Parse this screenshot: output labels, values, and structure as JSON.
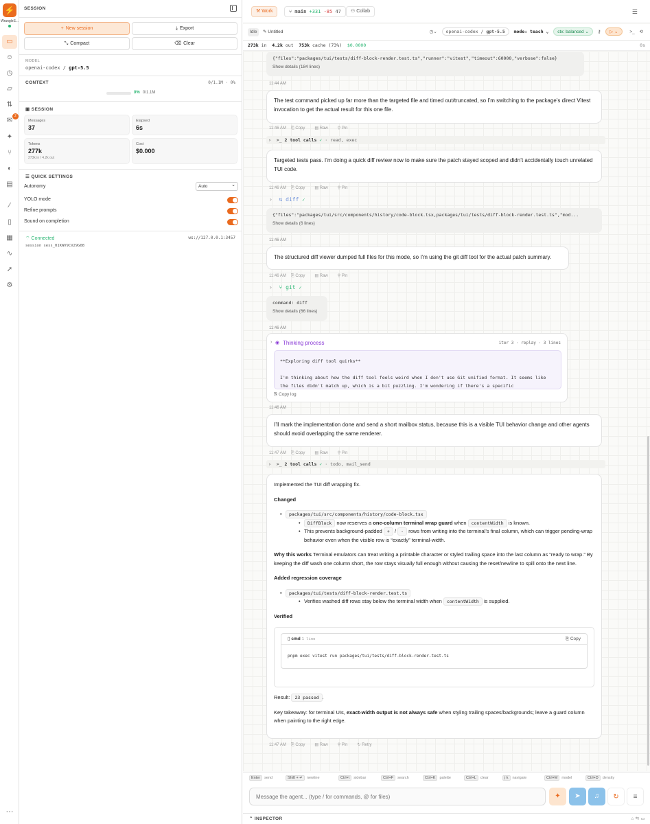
{
  "rail": {
    "brand": "WrangleS...",
    "badge": "2",
    "icons": [
      "chat-icon",
      "robot-icon",
      "history-icon",
      "folder-icon",
      "branches-icon",
      "mail-icon",
      "sparkles-icon",
      "git-icon",
      "palette-icon",
      "archive-icon",
      "wand-icon",
      "document-icon",
      "table-icon",
      "activity-icon",
      "rocket-icon",
      "settings-icon"
    ],
    "more": "···"
  },
  "sidebar": {
    "title": "SESSION",
    "buttons": {
      "new_session": "New session",
      "export": "Export",
      "compact": "Compact",
      "clear": "Clear"
    },
    "model": {
      "label": "MODEL",
      "provider": "openai-codex",
      "sep": "/",
      "name": "gpt-5.5"
    },
    "context": {
      "label": "CONTEXT",
      "right": "0/1.1M · 0%",
      "percent": "0%",
      "capacity": "0/1.1M",
      "fill": 0
    },
    "session": {
      "label": "SESSION",
      "stats": [
        {
          "key": "Messages",
          "value": "37",
          "sub": ""
        },
        {
          "key": "Elapsed",
          "value": "6s",
          "sub": ""
        },
        {
          "key": "Tokens",
          "value": "277k",
          "sub": "273k in / 4.2k out"
        },
        {
          "key": "Cost",
          "value": "$0.000",
          "sub": ""
        }
      ]
    },
    "quick_settings": {
      "label": "QUICK SETTINGS",
      "autonomy_label": "Autonomy",
      "autonomy_value": "Auto",
      "yolo": "YOLO mode",
      "refine": "Refine prompts",
      "sound": "Sound on completion"
    },
    "connection": {
      "status": "Connected",
      "url": "ws://127.0.0.1:3457",
      "session_id": "session sess_01KWV9CV29G08"
    }
  },
  "topbar": {
    "work": "Work",
    "branch": "main",
    "additions": "+331",
    "deletions": "-85",
    "files": "47",
    "collab": "Collab"
  },
  "session_bar": {
    "status": "Idle",
    "title": "Untitled",
    "provider": "openai-codex",
    "model": "gpt-5.5",
    "mode": "mode: teach",
    "ctx": "ctx: balanced"
  },
  "usage": {
    "in": "273k",
    "in_label": "in",
    "out": "4.2k",
    "out_label": "out",
    "cache": "753k",
    "cache_label": "cache (73%)",
    "cost": "$0.0000",
    "right": "0s"
  },
  "chat": {
    "tool_args_1": "{\"files\":\"packages/tui/tests/diff-block-render.test.ts\",\"runner\":\"vitest\",\"timeout\":60000,\"verbose\":false}",
    "show_details_1": "Show details (184 lines)",
    "time_1": "11:44 AM",
    "msg_1": "The test command picked up far more than the targeted file and timed out/truncated, so I’m switching to the package’s direct Vitest invocation to get the actual result for this one file.",
    "time_2": "11:46 AM",
    "tool_calls_1": "2 tool calls",
    "tool_calls_1_detail": "· read, exec",
    "msg_2": "Targeted tests pass. I’m doing a quick diff review now to make sure the patch stayed scoped and didn’t accidentally touch unrelated TUI code.",
    "time_3": "11:46 AM",
    "diff_tool": "diff",
    "tool_args_2": "{\"files\":\"packages/tui/src/components/history/code-block.tsx,packages/tui/tests/diff-block-render.test.ts\",\"mod...",
    "show_details_2": "Show details (6 lines)",
    "time_4": "11:46 AM",
    "msg_3": "The structured diff viewer dumped full files for this mode, so I’m using the git diff tool for the actual patch summary.",
    "time_5": "11:46 AM",
    "git_tool": "git",
    "tool_args_3": "command: diff",
    "show_details_3": "Show details (66 lines)",
    "time_6": "11:46 AM",
    "thinking_title": "Thinking process",
    "thinking_meta": "iter 3 · replay · 3 lines",
    "thinking_line_1": "**Exploring diff tool quirks**",
    "thinking_line_2": "I'm thinking about how the diff tool feels weird when I don't use Git unified format. It seems like the files didn't match up, which is a bit puzzling. I'm wondering if there's a specific",
    "copy_log": "Copy log",
    "time_7": "11:46 AM",
    "msg_4": "I’ll mark the implementation done and send a short mailbox status, because this is a visible TUI behavior change and other agents should avoid overlapping the same renderer.",
    "time_8": "11:47 AM",
    "tool_calls_2": "2 tool calls",
    "tool_calls_2_detail": "· todo, mail_send",
    "time_9": "11:47 AM",
    "actions": {
      "copy": "Copy",
      "raw": "Raw",
      "pin": "Pin",
      "retry": "Retry"
    }
  },
  "final": {
    "intro": "Implemented the TUI diff wrapping fix.",
    "changed_h": "Changed",
    "file_1": "packages/tui/src/components/history/code-block.tsx",
    "b1_code": "DiffBlock",
    "b1_a": "now reserves a",
    "b1_bold": "one-column terminal wrap guard",
    "b1_b": "when",
    "b1_code2": "contentWidth",
    "b1_c": "is known.",
    "b2_a": "This prevents background-padded",
    "b2_plus": "+",
    "b2_slash": "/",
    "b2_minus": "-",
    "b2_b": "rows from writing into the terminal’s final column, which can trigger pending-wrap behavior even when the visible row is “exactly” terminal-width.",
    "why_bold": "Why this works",
    "why_text": "Terminal emulators can treat writing a printable character or styled trailing space into the last column as “ready to wrap.” By keeping the diff wash one column short, the row stays visually full enough without causing the reset/newline to spill onto the next line.",
    "added_h": "Added regression coverage",
    "file_2": "packages/tui/tests/diff-block-render.test.ts",
    "c1_a": "Verifies washed diff rows stay below the terminal width when",
    "c1_code": "contentWidth",
    "c1_b": "is supplied.",
    "verified_h": "Verified",
    "cmd_label": "cmd",
    "cmd_lines": "1 line",
    "cmd_copy": "Copy",
    "cmd": "pnpm exec vitest run packages/tui/tests/diff-block-render.test.ts",
    "result_label": "Result:",
    "result_code": "23 passed",
    "result_end": ".",
    "key_a": "Key takeaway: for terminal UIs,",
    "key_bold": "exact-width output is not always safe",
    "key_b": "when styling trailing spaces/backgrounds; leave a guard column when painting to the right edge."
  },
  "hints": [
    {
      "key": "Enter",
      "label": "send"
    },
    {
      "key": "Shift + ↵",
      "label": "newline"
    },
    {
      "key": "Ctrl+\\",
      "label": "sidebar"
    },
    {
      "key": "Ctrl+F",
      "label": "search"
    },
    {
      "key": "Ctrl+K",
      "label": "palette"
    },
    {
      "key": "Ctrl+L",
      "label": "clear"
    },
    {
      "key": "j k",
      "label": "navigate"
    },
    {
      "key": "Ctrl+M",
      "label": "model"
    },
    {
      "key": "Ctrl+D",
      "label": "density"
    }
  ],
  "composer": {
    "placeholder": "Message the agent... (type / for commands, @ for files)"
  },
  "inspector": {
    "label": "INSPECTOR"
  },
  "colors": {
    "accent": "#ea6a1e",
    "success": "#2bb673",
    "danger": "#d64545",
    "thinking": "#8a3ad6",
    "tool": "#6b8fd8"
  }
}
